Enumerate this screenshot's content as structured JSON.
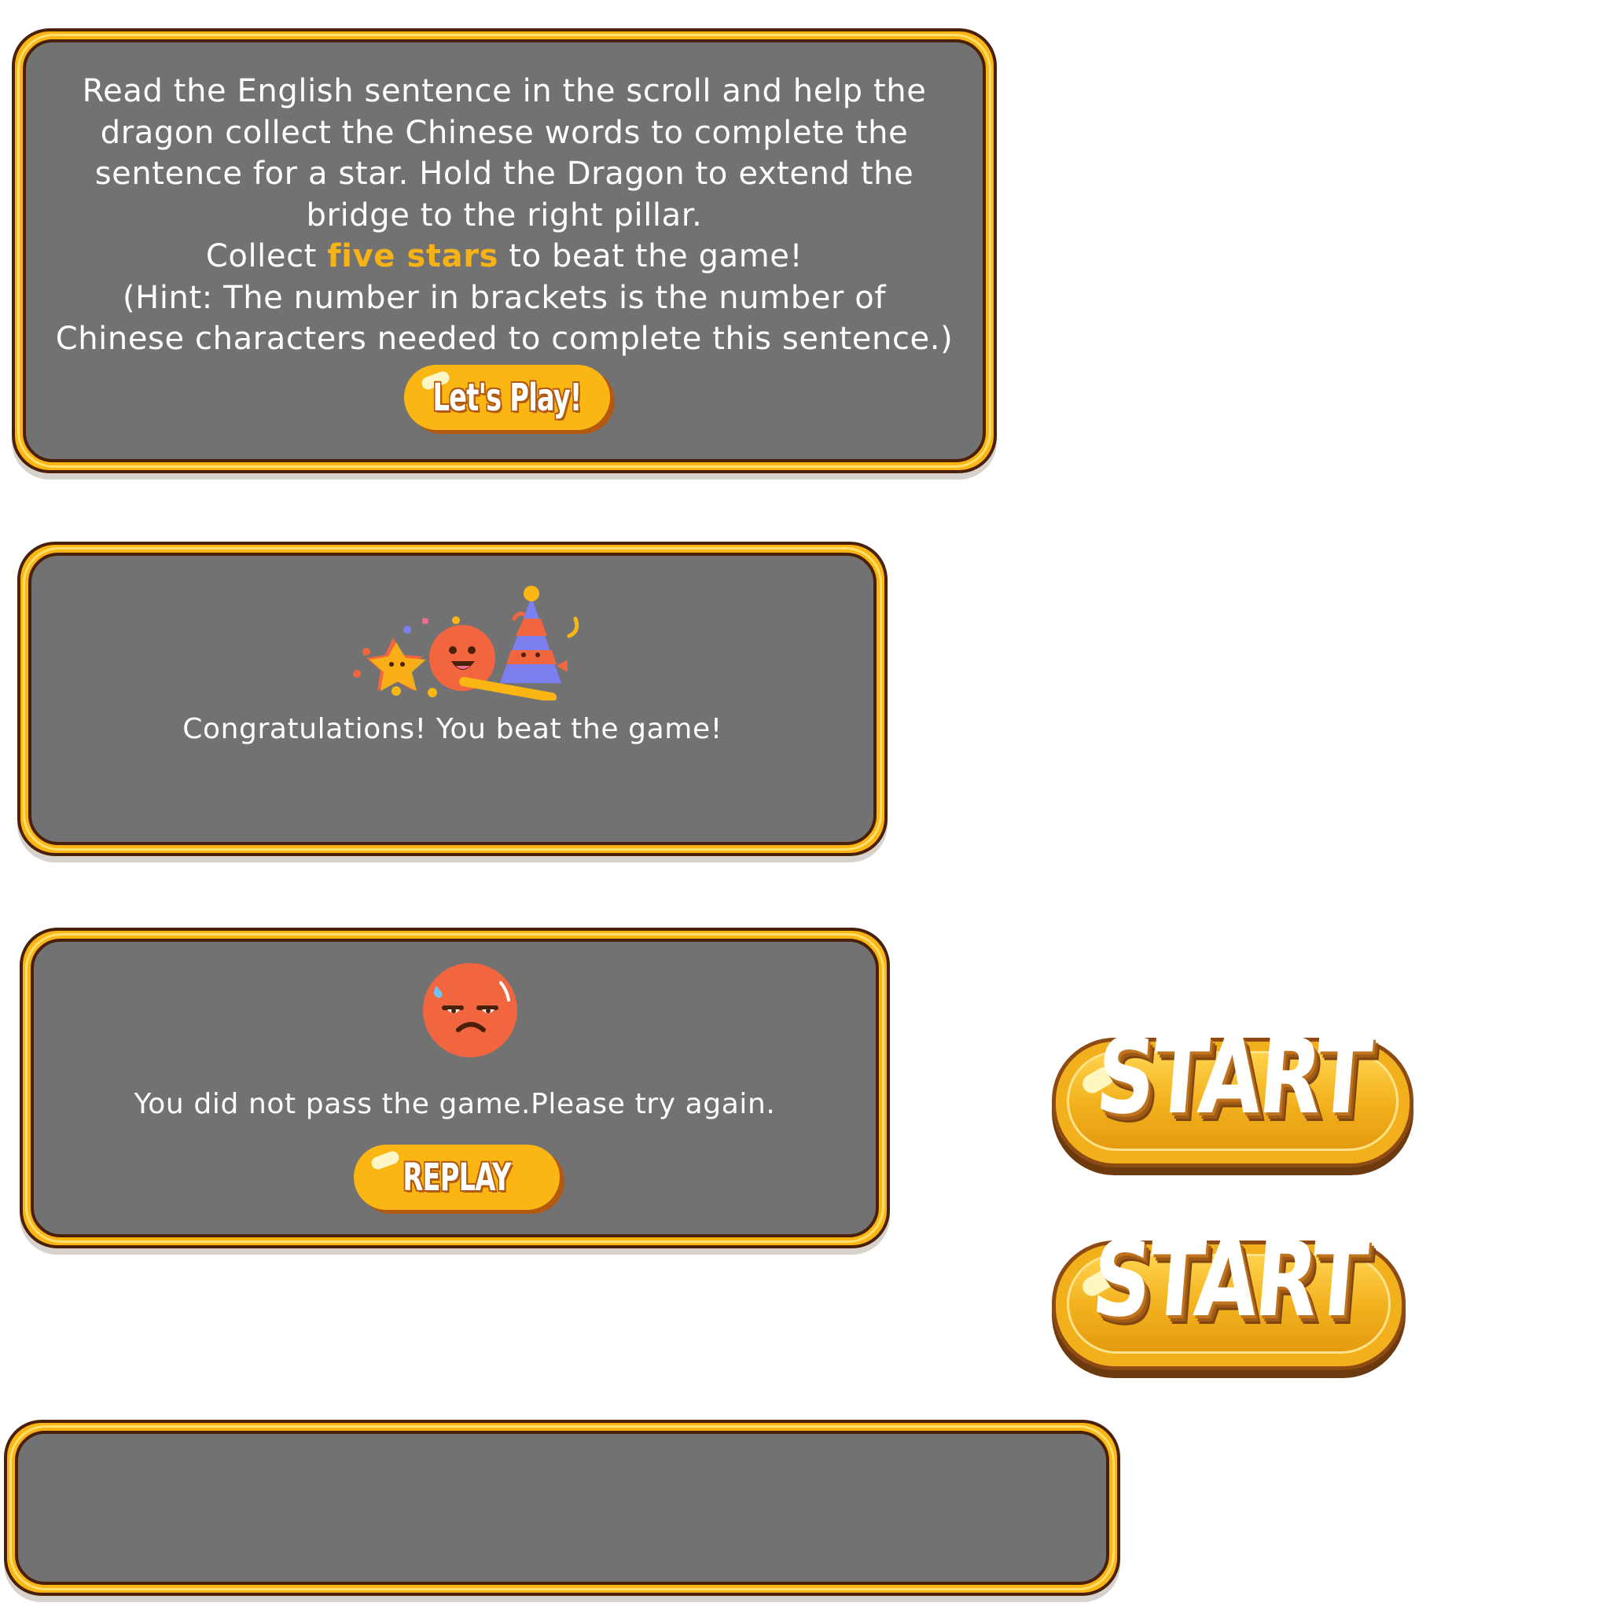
{
  "instructions_panel": {
    "line1": "Read the English sentence in the scroll and help the",
    "line2": "dragon collect the Chinese words to complete the",
    "line3": "sentence for a star.  Hold the Dragon to extend the",
    "line4": "bridge to the right pillar.",
    "line5_prefix": "Collect ",
    "line5_highlight": "five stars",
    "line5_suffix": " to beat the game!",
    "line6": "(Hint: The number in brackets is the number of",
    "line7": "Chinese characters needed to complete this sentence.)",
    "button_label": "Let's Play!"
  },
  "win_panel": {
    "message": "Congratulations! You beat the game!",
    "icon": "celebration-icon"
  },
  "lose_panel": {
    "message": "You did not pass the game.Please try again.",
    "icon": "sad-face-icon",
    "button_label": "REPLAY"
  },
  "start_buttons": [
    {
      "label": "START"
    },
    {
      "label": "START"
    }
  ],
  "colors": {
    "panel_fill": "#727272",
    "frame_gold": "#fbb614",
    "frame_outline": "#4a2108",
    "highlight": "#f7b216",
    "face": "#f2663f"
  }
}
